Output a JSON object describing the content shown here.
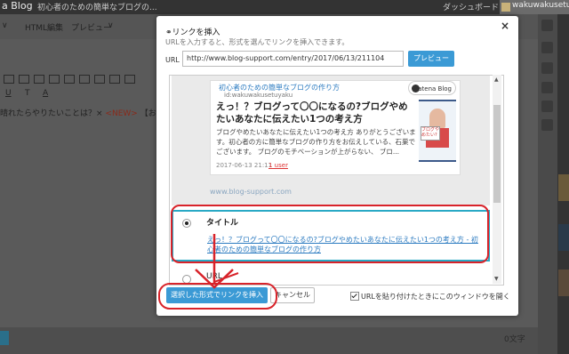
{
  "topbar": {
    "logo": "a Blog",
    "blog_name": "初心者のための簡単なブログの...",
    "dashboard": "ダッシュボード",
    "user": "wakuwakusetuyaku"
  },
  "editor": {
    "tab_html": "HTML編集",
    "tab_preview": "プレビュー",
    "content_line_prefix": "晴れたらやりたいことは？×",
    "content_line_new": "<NEW>",
    "content_line_suffix": "【お知ら",
    "char_count": "0文字"
  },
  "modal": {
    "title": "リンクを挿入",
    "subtitle": "URLを入力すると、形式を選んでリンクを挿入できます。",
    "url_label": "URL",
    "url_value": "http://www.blog-support.com/entry/2017/06/13/211104",
    "preview_button": "プレビュー",
    "close": "×",
    "card": {
      "blog_name": "初心者のための簡単なブログの作り方",
      "blog_id": "id:wakuwakusetuyaku",
      "hatena_badge": "Hatena Blog",
      "title": "えっ！？ブログって〇〇になるの?ブログやめたいあなたに伝えたい1つの考え方",
      "description": "ブログやめたいあなたに伝えたい1つの考え方 ありがとうございます。初心者の方に簡単なブログの作り方をお伝えしている、石巣でございます。 ブログのモチベーションが上がらない、 ブロ...",
      "date": "2017-06-13 21:11",
      "users": "1 user",
      "thumb_sign": "ブログやめたい?",
      "site": "www.blog-support.com"
    },
    "option_title_label": "タイトル",
    "option_title_link": "えっ！？ブログって〇〇になるの?ブログやめたいあなたに伝えたい1つの考え方 - 初心者のための簡単なブログの作り方",
    "option_url_label": "URL",
    "insert_button": "選択した形式でリンクを挿入",
    "cancel_button": "キャンセル",
    "checkbox_label": "URLを貼り付けたときにこのウィンドウを開く"
  },
  "colors": {
    "accent": "#3b9ad5",
    "highlight_border": "#29a9c5",
    "annotation": "#d8232a"
  }
}
